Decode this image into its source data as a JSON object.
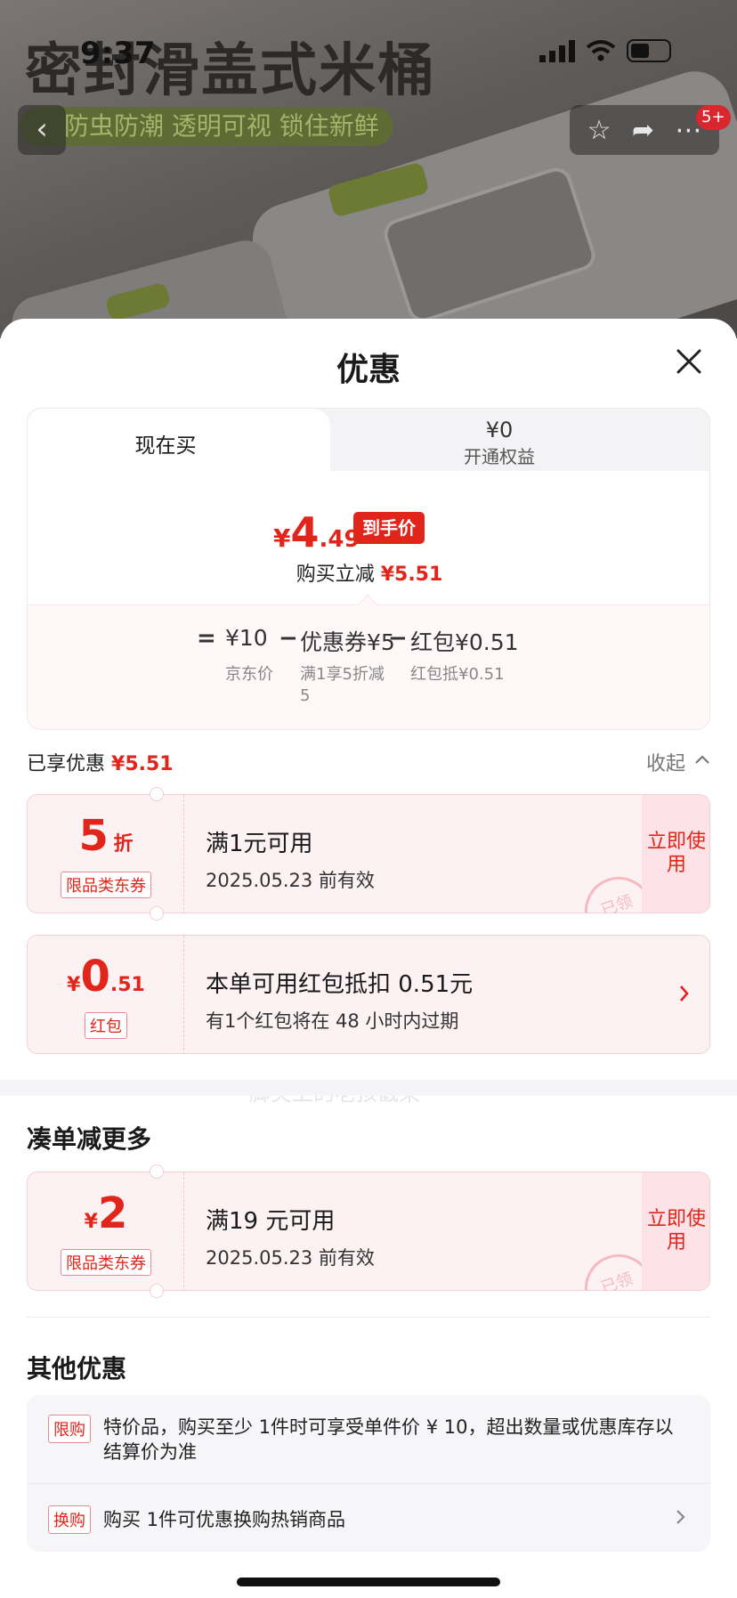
{
  "backdrop": {
    "product_title": "密封滑盖式米桶",
    "tagline": "防虫防潮 透明可视 锁住新鲜",
    "cart_badge": "5+"
  },
  "status_bar": {
    "time": "9:37",
    "battery": "30"
  },
  "sheet": {
    "title": "优惠",
    "tabs": [
      {
        "label": "现在买"
      },
      {
        "price": "¥0",
        "label": "开通权益"
      }
    ],
    "final_price": {
      "currency": "¥",
      "integer": "4",
      "decimal": ".49",
      "tag": "到手价"
    },
    "save_line": {
      "label": "购买立减",
      "amount": "¥5.51"
    },
    "breakdown": {
      "eq": "=",
      "base": {
        "value": "¥10",
        "label": "京东价"
      },
      "minus1": "−",
      "coupon": {
        "value": "优惠券¥5",
        "label": "满1享5折减5"
      },
      "minus2": "−",
      "redpacket": {
        "value": "红包¥0.51",
        "label": "红包抵¥0.51"
      }
    },
    "enjoyed": {
      "label": "已享优惠",
      "amount": "¥5.51"
    },
    "collapse_label": "收起",
    "coupons": [
      {
        "value_big": "5",
        "value_small": "折",
        "tag": "限品类东券",
        "title": "满1元可用",
        "desc": "2025.05.23 前有效",
        "action": "立即使用",
        "stamp": "已领"
      },
      {
        "currency": "¥",
        "value_big": "0",
        "value_small": ".51",
        "tag": "红包",
        "title": "本单可用红包抵扣 0.51元",
        "desc": "有1个红包将在 48 小时内过期"
      }
    ],
    "more_section": {
      "title": "凑单减更多",
      "coupon": {
        "currency": "¥",
        "value_big": "2",
        "tag": "限品类东券",
        "title": "满19 元可用",
        "desc": "2025.05.23 前有效",
        "action": "立即使用",
        "stamp": "已领"
      }
    },
    "other_section": {
      "title": "其他优惠",
      "items": [
        {
          "tag": "限购",
          "text": "特价品，购买至少 1件时可享受单件价 ¥ 10，超出数量或优惠库存以结算价为准"
        },
        {
          "tag": "换购",
          "text": "购买 1件可优惠换购热销商品"
        }
      ]
    },
    "watermark": "脚尖上的老孩戳茱"
  },
  "colors": {
    "accent": "#e1251b",
    "coupon_bg": "#fdf2f3"
  }
}
